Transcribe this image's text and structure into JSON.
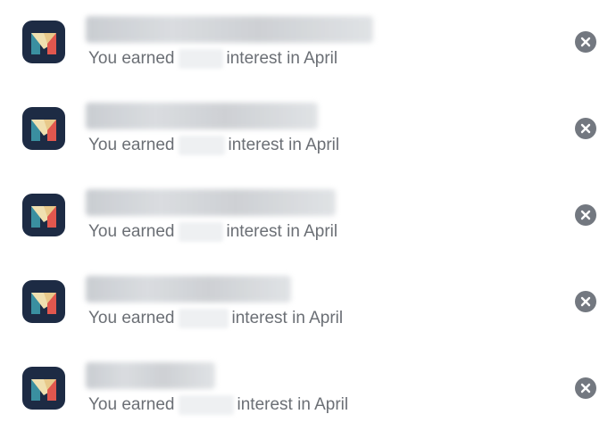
{
  "notifications": [
    {
      "app": "Monzo",
      "subtitle_prefix": "You earned",
      "subtitle_suffix": "interest in April",
      "icon": "monzo-app-icon",
      "dismiss_icon": "close-icon"
    },
    {
      "app": "Monzo",
      "subtitle_prefix": "You earned",
      "subtitle_suffix": "interest in April",
      "icon": "monzo-app-icon",
      "dismiss_icon": "close-icon"
    },
    {
      "app": "Monzo",
      "subtitle_prefix": "You earned",
      "subtitle_suffix": "interest in April",
      "icon": "monzo-app-icon",
      "dismiss_icon": "close-icon"
    },
    {
      "app": "Monzo",
      "subtitle_prefix": "You earned",
      "subtitle_suffix": "interest in April",
      "icon": "monzo-app-icon",
      "dismiss_icon": "close-icon"
    },
    {
      "app": "Monzo",
      "subtitle_prefix": "You earned",
      "subtitle_suffix": "interest in April",
      "icon": "monzo-app-icon",
      "dismiss_icon": "close-icon"
    }
  ],
  "colors": {
    "icon_background": "#1d2b44",
    "icon_teal": "#3a8fa0",
    "icon_cream": "#f0e0b0",
    "icon_red": "#e1574e",
    "subtitle_text": "#6b6f75",
    "dismiss_button": "#737880"
  }
}
